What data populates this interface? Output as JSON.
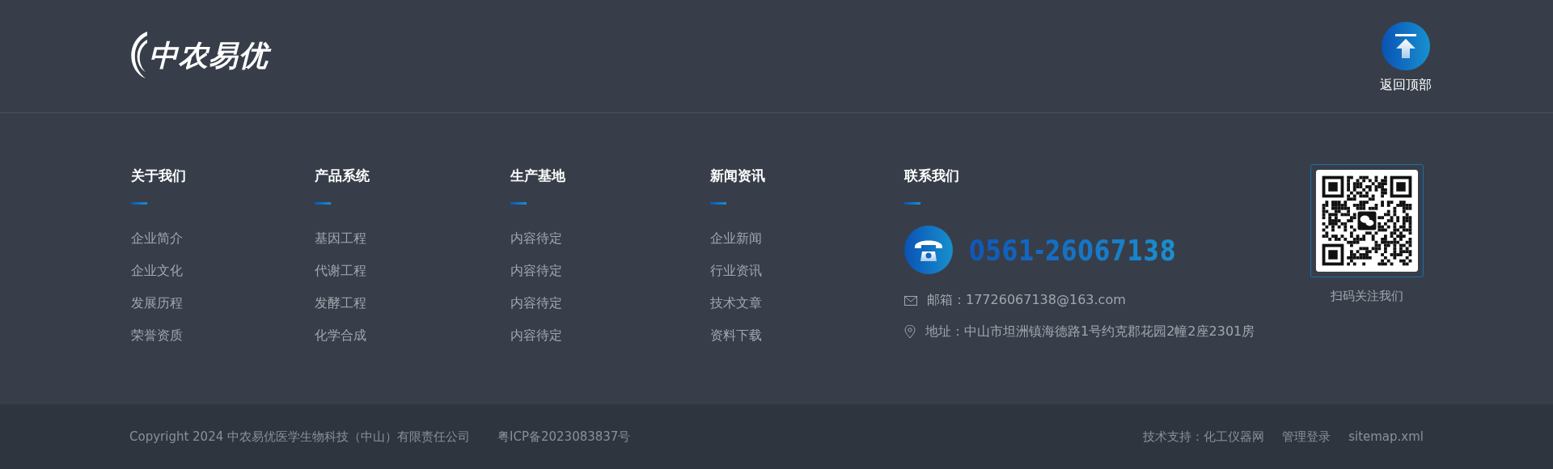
{
  "header": {
    "logo_text": "中农易优",
    "back_to_top": "返回顶部"
  },
  "columns": [
    {
      "title": "关于我们",
      "links": [
        "企业简介",
        "企业文化",
        "发展历程",
        "荣誉资质"
      ]
    },
    {
      "title": "产品系统",
      "links": [
        "基因工程",
        "代谢工程",
        "发酵工程",
        "化学合成"
      ]
    },
    {
      "title": "生产基地",
      "links": [
        "内容待定",
        "内容待定",
        "内容待定",
        "内容待定"
      ]
    },
    {
      "title": "新闻资讯",
      "links": [
        "企业新闻",
        "行业资讯",
        "技术文章",
        "资料下载"
      ]
    }
  ],
  "contact": {
    "title": "联系我们",
    "phone": "0561-26067138",
    "email": "邮箱：17726067138@163.com",
    "address": "地址：中山市坦洲镇海德路1号约克郡花园2幢2座2301房"
  },
  "qr": {
    "caption": "扫码关注我们"
  },
  "bottom_bar": {
    "copyright": "Copyright 2024 中农易优医学生物科技（中山）有限责任公司",
    "icp": "粤ICP备2023083837号",
    "links": [
      "技术支持：化工仪器网",
      "管理登录",
      "sitemap.xml"
    ]
  }
}
